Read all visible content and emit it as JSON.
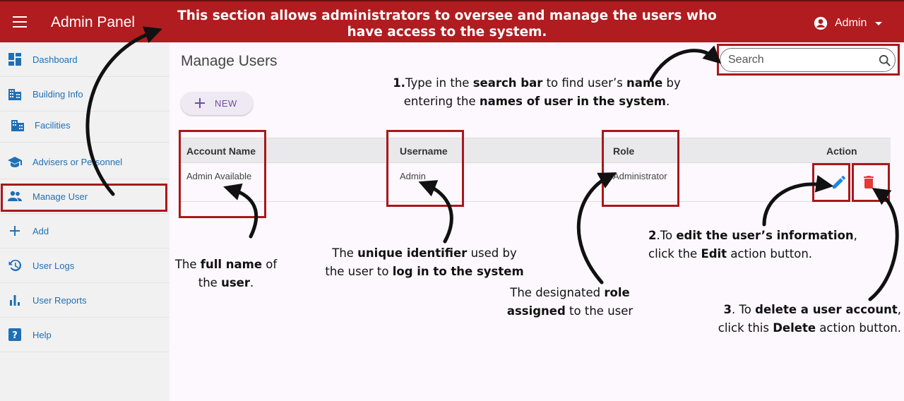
{
  "appbar": {
    "title": "Admin Panel",
    "banner": "This section allows administrators to oversee and manage the users who have access to the system.",
    "user_name": "Admin"
  },
  "sidebar": {
    "items": [
      {
        "label": "Dashboard",
        "icon": "dashboard-icon"
      },
      {
        "label": "Building Info",
        "icon": "building-icon"
      },
      {
        "label": "Facilities",
        "icon": "facilities-icon"
      },
      {
        "label": "Advisers or Personnel",
        "icon": "graduation-cap-icon"
      },
      {
        "label": "Manage User",
        "icon": "people-icon"
      },
      {
        "label": "Add",
        "icon": "plus-icon"
      },
      {
        "label": "User Logs",
        "icon": "history-icon"
      },
      {
        "label": "User Reports",
        "icon": "bar-chart-icon"
      },
      {
        "label": "Help",
        "icon": "help-icon"
      }
    ]
  },
  "main": {
    "title": "Manage Users",
    "search_placeholder": "Search",
    "new_label": "NEW",
    "columns": [
      "Account Name",
      "Username",
      "Role",
      "Action"
    ],
    "rows": [
      {
        "account_name": "Admin Available",
        "username": "Admin",
        "role": "Administrator"
      }
    ]
  },
  "notes": {
    "n1a": "1.",
    "n1b": "Type in the ",
    "n1c": "search bar",
    "n1d": " to find user’s ",
    "n1e": "name",
    "n1f": " by",
    "n1g": "entering the ",
    "n1h": "names of user in the system",
    "n1i": ".",
    "full_a": "The ",
    "full_b": "full name",
    "full_c": " of",
    "full_d": "the ",
    "full_e": "user",
    "full_f": ".",
    "uid_a": "The ",
    "uid_b": "unique identifier",
    "uid_c": " used by",
    "uid_d": "the user to ",
    "uid_e": "log in to the system",
    "role_a": "The designated ",
    "role_b": "role",
    "role_c": "assigned",
    "role_d": " to the user",
    "edit_a": "2",
    "edit_b": ".To ",
    "edit_c": "edit the user’s information",
    "edit_d": ",",
    "edit_e": "click the ",
    "edit_f": "Edit",
    "edit_g": " action button.",
    "del_a": "3",
    "del_b": ". To ",
    "del_c": "delete a user account",
    "del_d": ",",
    "del_e": "click this ",
    "del_f": "Delete",
    "del_g": " action button."
  },
  "colors": {
    "brand_red": "#b01c1f",
    "highlight": "#a8181c",
    "link_blue": "#1f6fb5",
    "edit_blue": "#1e88e5",
    "delete_red": "#e53935"
  }
}
